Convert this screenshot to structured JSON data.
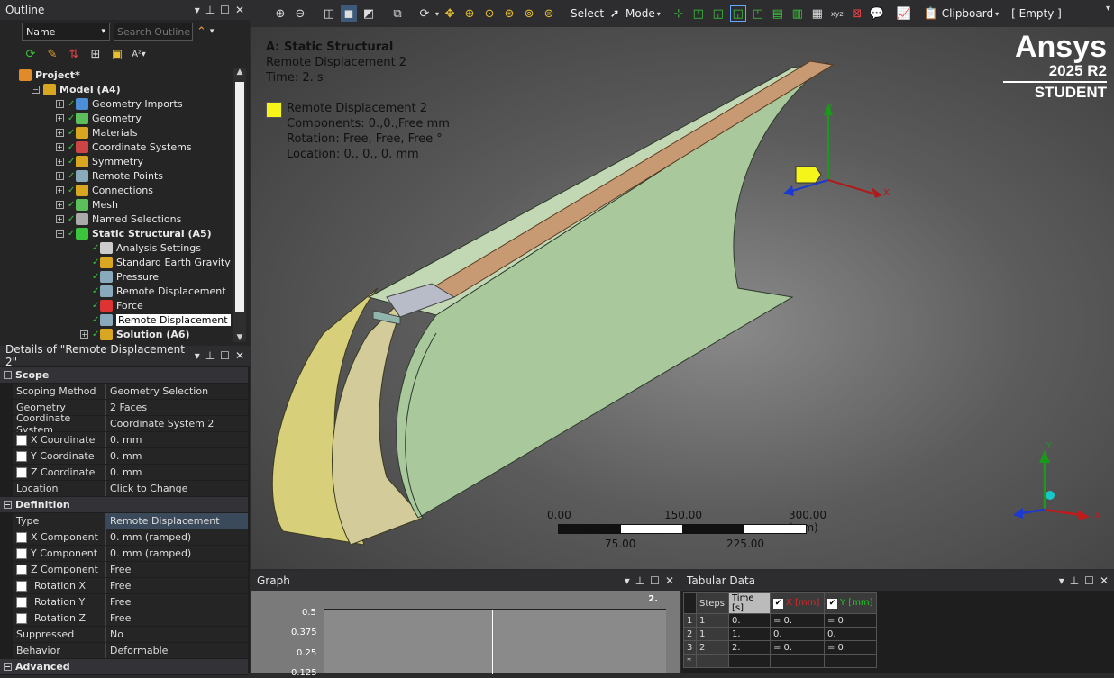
{
  "outline": {
    "title": "Outline",
    "filter_label": "Name",
    "search_placeholder": "Search Outline",
    "tree": [
      {
        "label": "Project*",
        "indent": 0,
        "bold": true,
        "color": "#e08a2a"
      },
      {
        "label": "Model (A4)",
        "indent": 1,
        "bold": true,
        "color": "#d9a621"
      },
      {
        "label": "Geometry Imports",
        "indent": 2,
        "color": "#4c8fd6"
      },
      {
        "label": "Geometry",
        "indent": 2,
        "color": "#5cbf5c"
      },
      {
        "label": "Materials",
        "indent": 2,
        "color": "#d9a621"
      },
      {
        "label": "Coordinate Systems",
        "indent": 2,
        "color": "#c44"
      },
      {
        "label": "Symmetry",
        "indent": 2,
        "color": "#d9a621"
      },
      {
        "label": "Remote Points",
        "indent": 2,
        "color": "#8ab"
      },
      {
        "label": "Connections",
        "indent": 2,
        "color": "#d9a621"
      },
      {
        "label": "Mesh",
        "indent": 2,
        "color": "#5cbf5c"
      },
      {
        "label": "Named Selections",
        "indent": 2,
        "color": "#aaa"
      },
      {
        "label": "Static Structural (A5)",
        "indent": 2,
        "bold": true,
        "color": "#3cc43c"
      },
      {
        "label": "Analysis Settings",
        "indent": 3,
        "color": "#ccc"
      },
      {
        "label": "Standard Earth Gravity",
        "indent": 3,
        "color": "#d9a621"
      },
      {
        "label": "Pressure",
        "indent": 3,
        "color": "#8ab"
      },
      {
        "label": "Remote Displacement",
        "indent": 3,
        "color": "#8ab"
      },
      {
        "label": "Force",
        "indent": 3,
        "color": "#d33"
      },
      {
        "label": "Remote Displacement 2",
        "indent": 3,
        "color": "#8ab",
        "selected": true
      },
      {
        "label": "Solution (A6)",
        "indent": 3,
        "bold": true,
        "color": "#d9a621"
      }
    ]
  },
  "details": {
    "title": "Details of \"Remote Displacement 2\"",
    "sections": [
      {
        "name": "Scope",
        "rows": [
          {
            "k": "Scoping Method",
            "v": "Geometry Selection"
          },
          {
            "k": "Geometry",
            "v": "2 Faces"
          },
          {
            "k": "Coordinate System",
            "v": "Coordinate System 2"
          },
          {
            "k": "X Coordinate",
            "v": "0. mm",
            "cb": true
          },
          {
            "k": "Y Coordinate",
            "v": "0. mm",
            "cb": true
          },
          {
            "k": "Z Coordinate",
            "v": "0. mm",
            "cb": true
          },
          {
            "k": "Location",
            "v": "Click to Change"
          }
        ]
      },
      {
        "name": "Definition",
        "rows": [
          {
            "k": "Type",
            "v": "Remote Displacement",
            "hl": true
          },
          {
            "k": "X Component",
            "v": "0. mm  (ramped)",
            "cb": true
          },
          {
            "k": "Y Component",
            "v": "0. mm  (ramped)",
            "cb": true
          },
          {
            "k": "Z Component",
            "v": "Free",
            "cb": true
          },
          {
            "k": "Rotation X",
            "v": "Free",
            "cb": true
          },
          {
            "k": "Rotation Y",
            "v": "Free",
            "cb": true
          },
          {
            "k": "Rotation Z",
            "v": "Free",
            "cb": true
          },
          {
            "k": "Suppressed",
            "v": "No"
          },
          {
            "k": "Behavior",
            "v": "Deformable"
          }
        ]
      },
      {
        "name": "Advanced",
        "rows": []
      }
    ]
  },
  "toolbar": {
    "select_label": "Select",
    "mode_label": "Mode",
    "clipboard_label": "Clipboard",
    "empty_label": "[ Empty ]"
  },
  "viewport": {
    "title": "A: Static Structural",
    "subtitle": "Remote Displacement 2",
    "time": "Time: 2. s",
    "legend_name": "Remote Displacement 2",
    "legend_components": "Components: 0.,0.,Free mm",
    "legend_rotation": "Rotation: Free, Free, Free °",
    "legend_location": "Location: 0., 0., 0. mm",
    "legend_color": "#f5f51a",
    "brand": "Ansys",
    "version": "2025 R2",
    "edition": "STUDENT",
    "scale_top": [
      "0.00",
      "150.00",
      "300.00 (mm)"
    ],
    "scale_bottom": [
      "75.00",
      "225.00"
    ],
    "axis_x": "X",
    "axis_y": "Y"
  },
  "graph": {
    "title": "Graph",
    "marker": "2.",
    "yticks": [
      "0.5",
      "0.375",
      "0.25",
      "0.125"
    ]
  },
  "tabular": {
    "title": "Tabular Data",
    "headers": [
      "Steps",
      "Time [s]",
      "X [mm]",
      "Y [mm]"
    ],
    "rows": [
      {
        "n": "1",
        "steps": "1",
        "time": "0.",
        "x": "= 0.",
        "y": "= 0."
      },
      {
        "n": "2",
        "steps": "1",
        "time": "1.",
        "x": "0.",
        "y": "0."
      },
      {
        "n": "3",
        "steps": "2",
        "time": "2.",
        "x": "= 0.",
        "y": "= 0."
      }
    ],
    "new_row": "*"
  }
}
